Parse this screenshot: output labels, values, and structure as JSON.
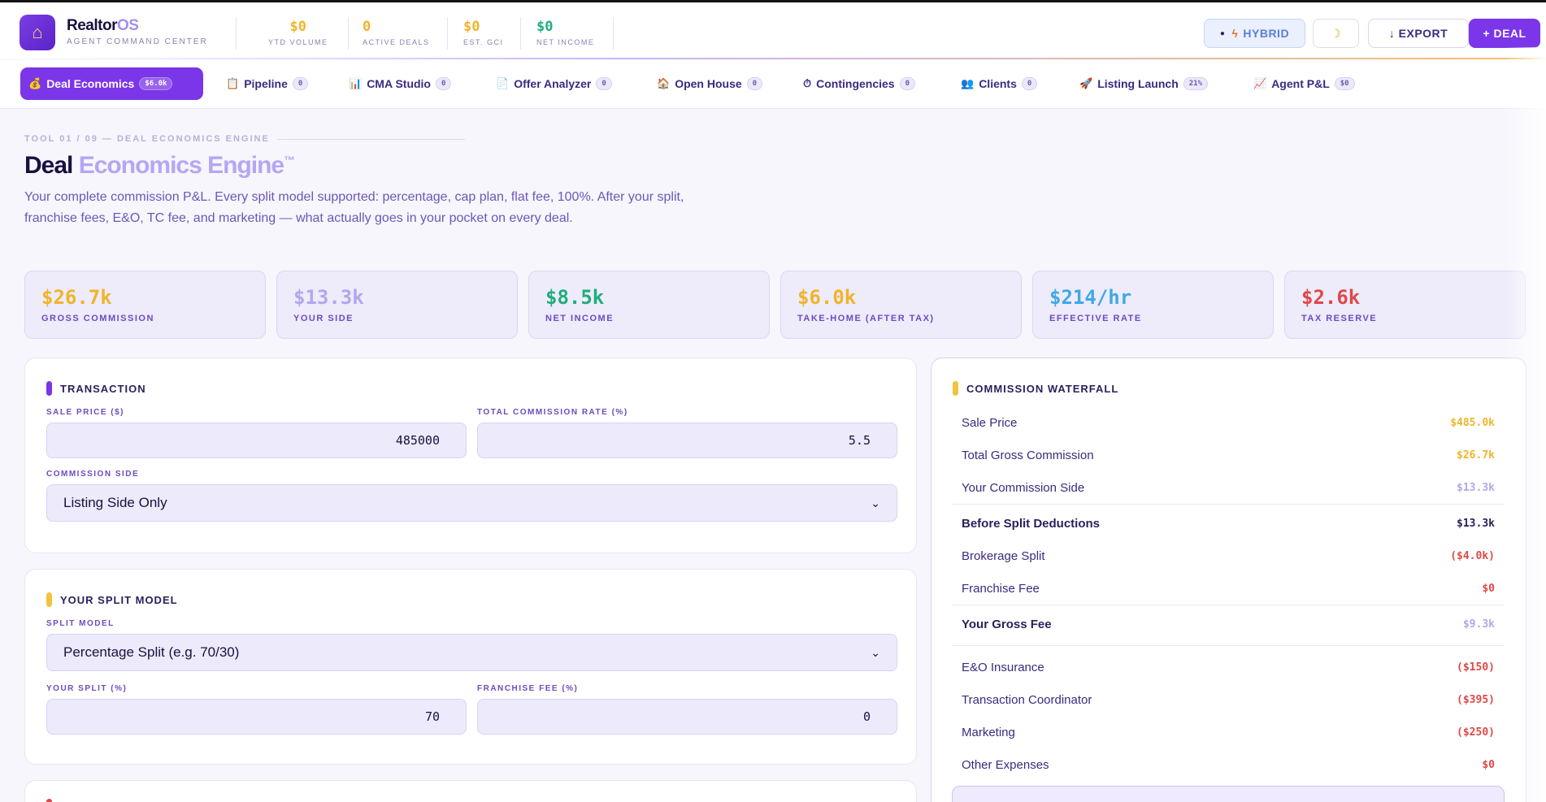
{
  "app": {
    "brand": "Realtor",
    "brand_suffix": "OS",
    "subtitle": "AGENT COMMAND CENTER",
    "logo_icon": "house-icon"
  },
  "header_stats": [
    {
      "value": "$0",
      "label": "YTD VOLUME",
      "color": "#f0b429"
    },
    {
      "value": "0",
      "label": "ACTIVE DEALS",
      "color": "#f0b429"
    },
    {
      "value": "$0",
      "label": "EST. GCI",
      "color": "#f0b429"
    },
    {
      "value": "$0",
      "label": "NET INCOME",
      "color": "#1fae7a"
    }
  ],
  "header_buttons": {
    "hybrid": "HYBRID",
    "moon": "☽",
    "export": "↓ EXPORT",
    "deal": "+ DEAL"
  },
  "tabs": [
    {
      "icon": "💰",
      "label": "Deal Economics",
      "badge": "$6.0k"
    },
    {
      "icon": "📋",
      "label": "Pipeline",
      "badge": "0"
    },
    {
      "icon": "📊",
      "label": "CMA Studio",
      "badge": "0"
    },
    {
      "icon": "📄",
      "label": "Offer Analyzer",
      "badge": "0"
    },
    {
      "icon": "🏠",
      "label": "Open House",
      "badge": "0"
    },
    {
      "icon": "⏱",
      "label": "Contingencies",
      "badge": "0"
    },
    {
      "icon": "👥",
      "label": "Clients",
      "badge": "0"
    },
    {
      "icon": "🚀",
      "label": "Listing Launch",
      "badge": "21%"
    },
    {
      "icon": "📈",
      "label": "Agent P&L",
      "badge": "$0"
    }
  ],
  "page": {
    "eyebrow": "TOOL 01 / 09 — DEAL ECONOMICS ENGINE",
    "title_a": "Deal",
    "title_b": "Economics Engine",
    "title_tm": "™",
    "description": "Your complete commission P&L. Every split model supported: percentage, cap plan, flat fee, 100%. After your split, franchise fees, E&O, TC fee, and marketing — what actually goes in your pocket on every deal."
  },
  "kpis": [
    {
      "value": "$26.7k",
      "label": "GROSS COMMISSION",
      "color": "#f0b429"
    },
    {
      "value": "$13.3k",
      "label": "YOUR SIDE",
      "color": "#b3a6ee"
    },
    {
      "value": "$8.5k",
      "label": "NET INCOME",
      "color": "#1fae7a"
    },
    {
      "value": "$6.0k",
      "label": "TAKE-HOME (AFTER TAX)",
      "color": "#f0b429"
    },
    {
      "value": "$214/hr",
      "label": "EFFECTIVE RATE",
      "color": "#3fa9e6"
    },
    {
      "value": "$2.6k",
      "label": "TAX RESERVE",
      "color": "#e04848"
    }
  ],
  "transaction": {
    "heading": "TRANSACTION",
    "sale_price_label": "SALE PRICE ($)",
    "sale_price": "485000",
    "rate_label": "TOTAL COMMISSION RATE (%)",
    "rate": "5.5",
    "side_label": "COMMISSION SIDE",
    "side": "Listing Side Only"
  },
  "split": {
    "heading": "YOUR SPLIT MODEL",
    "model_label": "SPLIT MODEL",
    "model": "Percentage Split (e.g. 70/30)",
    "your_split_label": "YOUR SPLIT (%)",
    "your_split": "70",
    "franchise_label": "FRANCHISE FEE (%)",
    "franchise": "0"
  },
  "waterfall": {
    "heading": "COMMISSION WATERFALL",
    "rows": [
      {
        "label": "Sale Price",
        "amount": "$485.0k",
        "color": "#f0b429"
      },
      {
        "label": "Total Gross Commission",
        "amount": "$26.7k",
        "color": "#f0b429"
      },
      {
        "label": "Your Commission Side",
        "amount": "$13.3k",
        "color": "#b3a6ee"
      },
      {
        "label": "Before Split Deductions",
        "amount": "$13.3k",
        "color": "#2a1f5c"
      },
      {
        "label": "Brokerage Split",
        "amount": "($4.0k)",
        "color": "#e04848"
      },
      {
        "label": "Franchise Fee",
        "amount": "$0",
        "color": "#e04848"
      },
      {
        "label": "Your Gross Fee",
        "amount": "$9.3k",
        "color": "#b3a6ee"
      },
      {
        "label": "E&O Insurance",
        "amount": "($150)",
        "color": "#e04848"
      },
      {
        "label": "Transaction Coordinator",
        "amount": "($395)",
        "color": "#e04848"
      },
      {
        "label": "Marketing",
        "amount": "($250)",
        "color": "#e04848"
      },
      {
        "label": "Other Expenses",
        "amount": "$0",
        "color": "#e04848"
      }
    ]
  }
}
